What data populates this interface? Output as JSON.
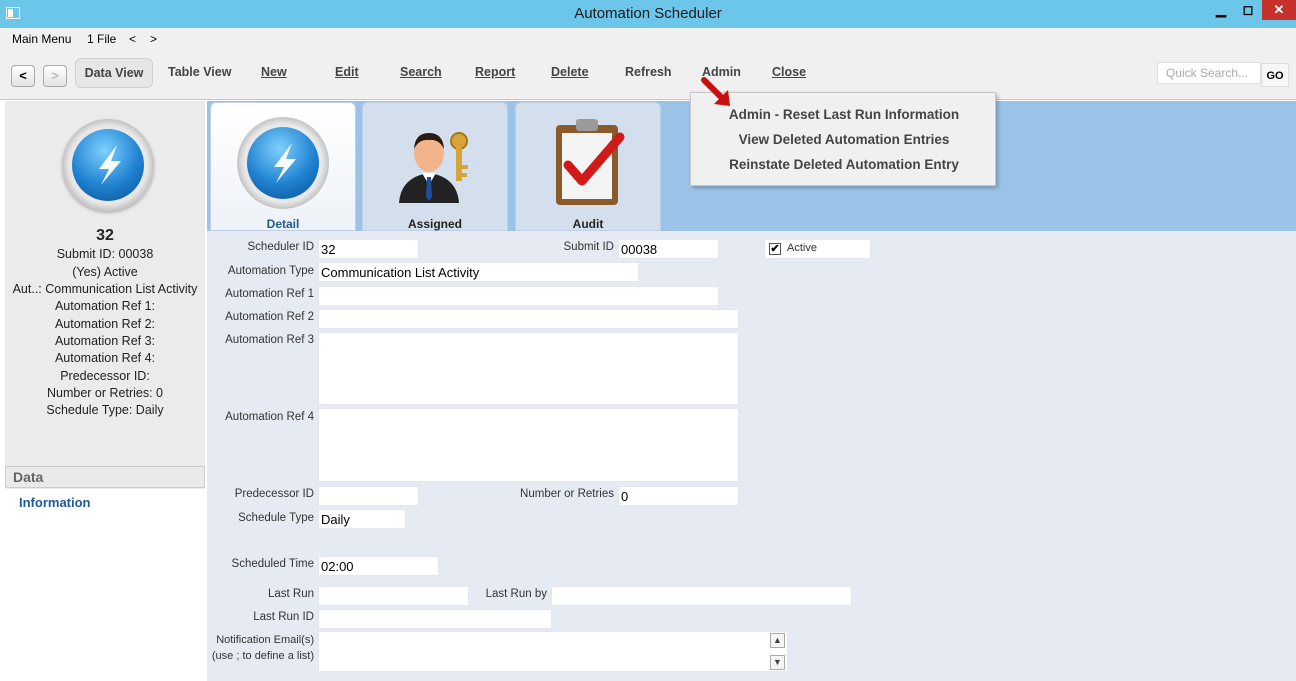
{
  "window": {
    "title": "Automation Scheduler",
    "min": "▁",
    "max": "◻",
    "close": "✕"
  },
  "menubar": {
    "main_menu": "Main Menu",
    "file": "1 File",
    "back": "<",
    "forward": ">"
  },
  "toolbar": {
    "back": "<",
    "forward": ">",
    "data_view": "Data View",
    "table_view": "Table View",
    "new": "New",
    "edit": "Edit",
    "search": "Search",
    "report": "Report",
    "delete": "Delete",
    "refresh": "Refresh",
    "admin": "Admin",
    "close": "Close",
    "quick_search_placeholder": "Quick Search...",
    "go": "GO"
  },
  "admin_menu": {
    "items": [
      "Admin - Reset Last Run Information",
      "View Deleted Automation Entries",
      "Reinstate Deleted Automation Entry"
    ]
  },
  "left_panel": {
    "id": "32",
    "lines": [
      "Submit ID: 00038",
      "(Yes) Active",
      "Aut..: Communication List Activity",
      "Automation Ref 1:",
      "Automation Ref 2:",
      "Automation Ref 3:",
      "Automation Ref 4:",
      "Predecessor ID:",
      "Number or Retries: 0",
      "Schedule Type: Daily"
    ],
    "section": "Data",
    "link": "Information"
  },
  "tabs": [
    "Detail",
    "Assigned",
    "Audit"
  ],
  "form": {
    "scheduler_id_label": "Scheduler ID",
    "scheduler_id": "32",
    "submit_id_label": "Submit ID",
    "submit_id": "00038",
    "active_label": "Active",
    "active_check": "✔",
    "automation_type_label": "Automation Type",
    "automation_type": "Communication List Activity",
    "ref1_label": "Automation Ref 1",
    "ref1": "",
    "ref2_label": "Automation Ref 2",
    "ref2": "",
    "ref3_label": "Automation Ref 3",
    "ref3": "",
    "ref4_label": "Automation Ref 4",
    "ref4": "",
    "predecessor_label": "Predecessor ID",
    "predecessor": "",
    "retries_label": "Number or Retries",
    "retries": "0",
    "schedule_type_label": "Schedule Type",
    "schedule_type": "Daily",
    "scheduled_time_label": "Scheduled Time",
    "scheduled_time": "02:00",
    "last_run_label": "Last Run",
    "last_run": "",
    "last_run_by_label": "Last Run by",
    "last_run_by": "",
    "last_run_id_label": "Last Run ID",
    "last_run_id": "",
    "notification_label_1": "Notification Email(s)",
    "notification_label_2": "(use ; to define a list)",
    "notification": "",
    "scroll_up": "▲",
    "scroll_down": "▼"
  }
}
